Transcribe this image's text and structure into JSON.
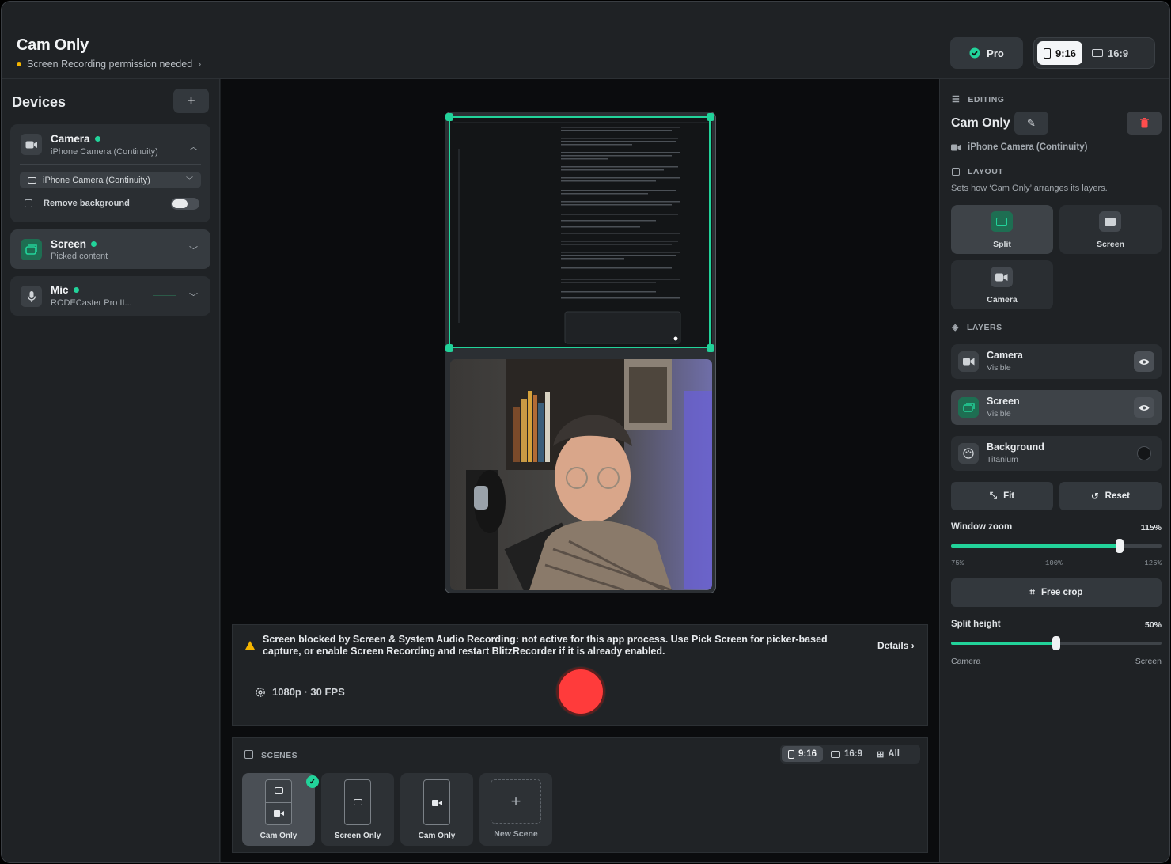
{
  "window": {
    "title": "Cam Only",
    "permission_notice": "Screen Recording permission needed",
    "pro_label": "Pro",
    "aspect_options": [
      "9:16",
      "16:9"
    ],
    "aspect_selected": "9:16"
  },
  "devices": {
    "title": "Devices",
    "add_label": "+",
    "camera": {
      "name": "Camera",
      "detail": "iPhone Camera (Continuity)",
      "select_value": "iPhone Camera (Continuity)",
      "remove_bg_label": "Remove background",
      "remove_bg_on": false
    },
    "screen": {
      "name": "Screen",
      "detail": "Picked content"
    },
    "mic": {
      "name": "Mic",
      "detail": "RODECaster Pro II..."
    }
  },
  "preview": {
    "layout": "Split",
    "split_fraction": 0.5
  },
  "notice": {
    "message": "Screen blocked by Screen & System Audio Recording: not active for this app process. Use Pick Screen for picker-based capture, or enable Screen Recording and restart BlitzRecorder if it is already enabled.",
    "details_label": "Details"
  },
  "recording": {
    "quality": "1080p · 30 FPS"
  },
  "scenes": {
    "title": "SCENES",
    "filters": [
      "9:16",
      "16:9",
      "All"
    ],
    "filter_selected": "9:16",
    "items": [
      {
        "label": "Cam Only",
        "selected": true
      },
      {
        "label": "Screen Only",
        "selected": false
      },
      {
        "label": "Cam Only",
        "selected": false
      }
    ],
    "new_label": "New Scene"
  },
  "editing": {
    "section": "EDITING",
    "scene_name": "Cam Only",
    "source": "iPhone Camera (Continuity)",
    "layout_section": "LAYOUT",
    "layout_desc": "Sets how ‘Cam Only’ arranges its layers.",
    "layouts": [
      "Split",
      "Screen",
      "Camera"
    ],
    "layout_selected": "Split",
    "layers_section": "LAYERS",
    "layers": [
      {
        "name": "Camera",
        "state": "Visible"
      },
      {
        "name": "Screen",
        "state": "Visible"
      },
      {
        "name": "Background",
        "state": "Titanium"
      }
    ],
    "fit_label": "Fit",
    "reset_label": "Reset",
    "zoom_label": "Window zoom",
    "zoom_value": "115%",
    "zoom_fraction": 0.8,
    "zoom_ticks": [
      "75%",
      "100%",
      "125%"
    ],
    "crop_label": "Free crop",
    "split_label": "Split height",
    "split_value": "50%",
    "split_fraction": 0.5,
    "split_ends": [
      "Camera",
      "Screen"
    ]
  },
  "colors": {
    "accent": "#22d39a",
    "record": "#ff3b3b",
    "warning": "#f4b400"
  }
}
